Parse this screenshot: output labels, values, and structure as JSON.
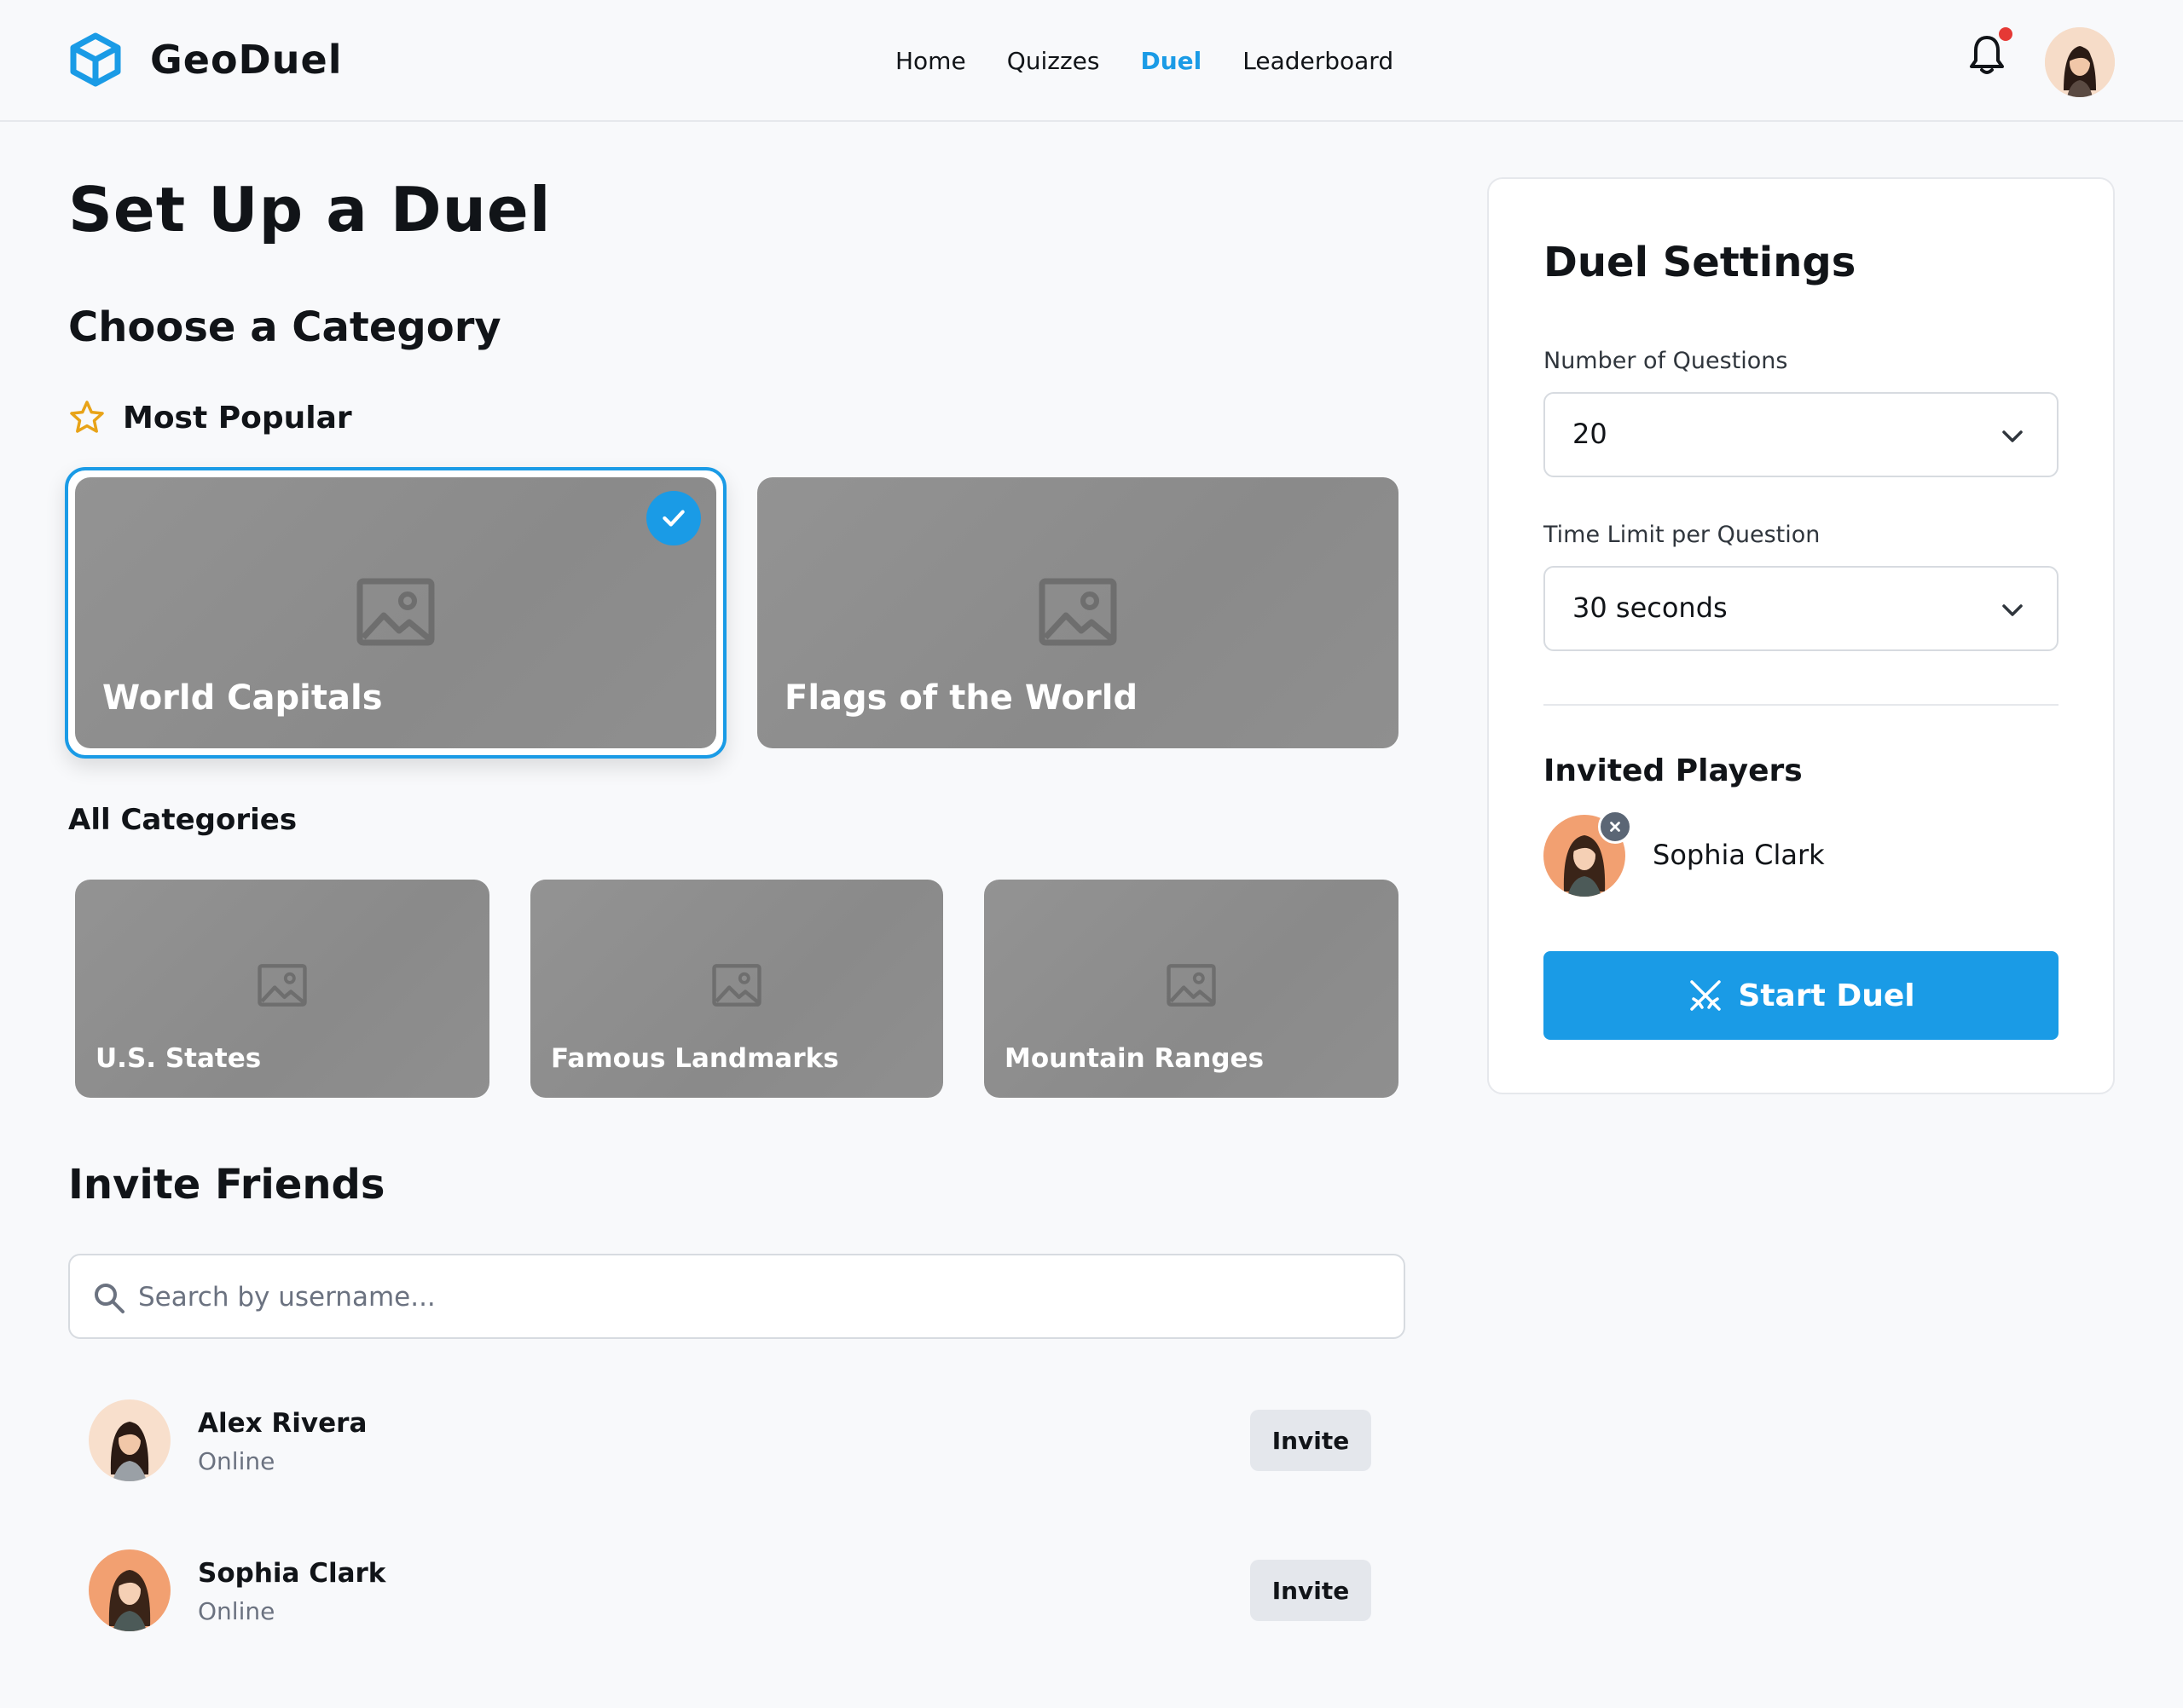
{
  "app": {
    "name": "GeoDuel"
  },
  "nav": {
    "items": [
      {
        "label": "Home",
        "active": false
      },
      {
        "label": "Quizzes",
        "active": false
      },
      {
        "label": "Duel",
        "active": true
      },
      {
        "label": "Leaderboard",
        "active": false
      }
    ]
  },
  "page": {
    "title": "Set Up a Duel"
  },
  "category": {
    "heading": "Choose a Category",
    "popular_heading": "Most Popular",
    "popular": [
      {
        "label": "World Capitals",
        "selected": true
      },
      {
        "label": "Flags of the World",
        "selected": false
      }
    ],
    "all_heading": "All Categories",
    "all": [
      {
        "label": "U.S. States"
      },
      {
        "label": "Famous Landmarks"
      },
      {
        "label": "Mountain Ranges"
      }
    ]
  },
  "invite": {
    "heading": "Invite Friends",
    "search_placeholder": "Search by username...",
    "friends": [
      {
        "name": "Alex Rivera",
        "status": "Online",
        "button": "Invite"
      },
      {
        "name": "Sophia Clark",
        "status": "Online",
        "button": "Invite"
      }
    ]
  },
  "settings": {
    "title": "Duel Settings",
    "questions_label": "Number of Questions",
    "questions_value": "20",
    "time_label": "Time Limit per Question",
    "time_value": "30 seconds",
    "invited_heading": "Invited Players",
    "invited": [
      {
        "name": "Sophia Clark"
      }
    ],
    "start_label": "Start Duel"
  },
  "colors": {
    "accent": "#1a9be6",
    "star": "#e8a317",
    "notification": "#e53935"
  },
  "icons": [
    "cube-logo-icon",
    "bell-icon",
    "star-icon",
    "image-placeholder-icon",
    "check-icon",
    "search-icon",
    "chevron-down-icon",
    "close-icon",
    "swords-icon"
  ]
}
